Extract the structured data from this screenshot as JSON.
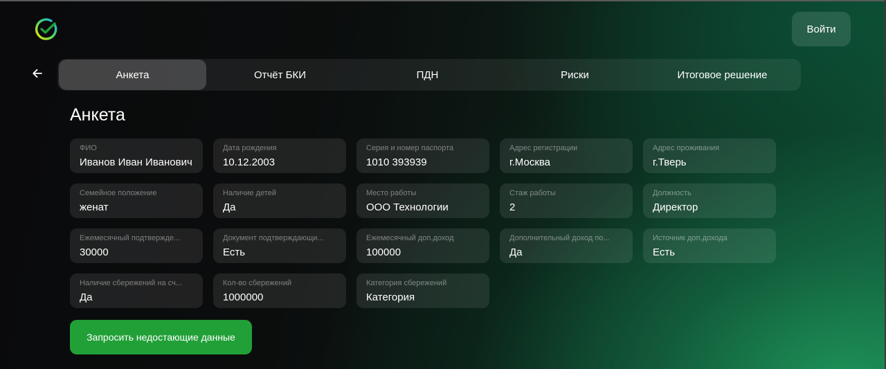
{
  "header": {
    "logo_icon": "sber-check-logo-icon",
    "login_label": "Войти"
  },
  "nav": {
    "back_icon": "arrow-left-icon",
    "tabs": [
      {
        "label": "Анкета",
        "active": true
      },
      {
        "label": "Отчёт БКИ",
        "active": false
      },
      {
        "label": "ПДН",
        "active": false
      },
      {
        "label": "Риски",
        "active": false
      },
      {
        "label": "Итоговое решение",
        "active": false
      }
    ]
  },
  "main": {
    "title": "Анкета",
    "fields": [
      {
        "label": "ФИО",
        "value": "Иванов Иван Иванович"
      },
      {
        "label": "Дата рождения",
        "value": "10.12.2003"
      },
      {
        "label": "Серия и номер паспорта",
        "value": "1010 393939"
      },
      {
        "label": "Адрес регистрации",
        "value": "г.Москва"
      },
      {
        "label": "Адрес проживания",
        "value": "г.Тверь"
      },
      {
        "label": "Семейное положение",
        "value": "женат"
      },
      {
        "label": "Наличие детей",
        "value": "Да"
      },
      {
        "label": "Место работы",
        "value": "ООО Технологии"
      },
      {
        "label": "Стаж работы",
        "value": "2"
      },
      {
        "label": "Должность",
        "value": "Директор"
      },
      {
        "label": "Ежемесячный подтверждe...",
        "value": "30000"
      },
      {
        "label": "Документ подтверждающи...",
        "value": "Есть"
      },
      {
        "label": "Ежемесячный доп.доход",
        "value": "100000"
      },
      {
        "label": "Дополнительный доход по...",
        "value": "Да"
      },
      {
        "label": "Источник доп.дохода",
        "value": "Есть"
      },
      {
        "label": "Наличие сбережений на сч...",
        "value": "Да"
      },
      {
        "label": "Кол-во сбережений",
        "value": "1000000"
      },
      {
        "label": "Категория сбережений",
        "value": "Категория"
      }
    ],
    "submit_label": "Запросить недостающие данные"
  },
  "colors": {
    "accent_green": "#21a038",
    "background_dark": "#0a0a0c",
    "background_green": "#145a38"
  }
}
